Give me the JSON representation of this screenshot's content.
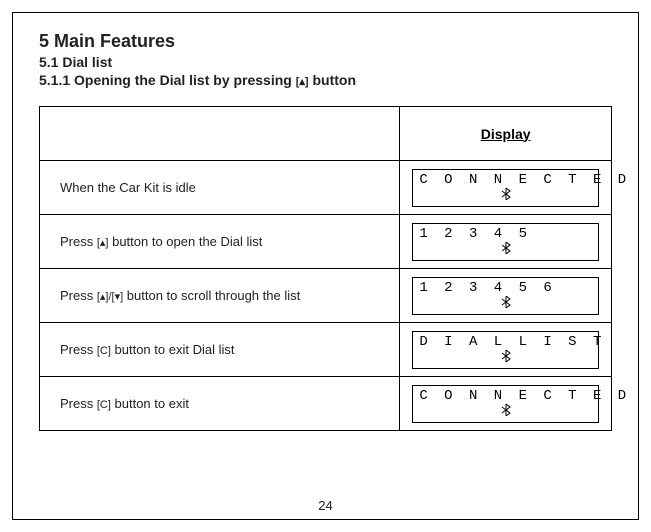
{
  "headings": {
    "chapter": "5  Main Features",
    "section": "5.1  Dial list",
    "subsection_prefix": "5.1.1  Opening the Dial list by pressing ",
    "subsection_button": "[▴]",
    "subsection_suffix": " button"
  },
  "table": {
    "header_left": "",
    "header_right": "Display",
    "rows": [
      {
        "instruction_parts": [
          "When the Car Kit is idle"
        ],
        "display": "C O N N E C T E D"
      },
      {
        "instruction_parts": [
          "Press ",
          "[▴]",
          " button to open the Dial list"
        ],
        "display": "1 2 3 4 5"
      },
      {
        "instruction_parts": [
          "Press ",
          "[▴]/[▾]",
          " button to scroll through the list"
        ],
        "display": "1 2 3 4 5 6"
      },
      {
        "instruction_parts": [
          "Press ",
          "[C]",
          " button to exit Dial list"
        ],
        "display": "D I A L   L I S T"
      },
      {
        "instruction_parts": [
          "Press ",
          "[C]",
          " button to exit"
        ],
        "display": "C O N N E C T E D"
      }
    ]
  },
  "page_number": "24"
}
